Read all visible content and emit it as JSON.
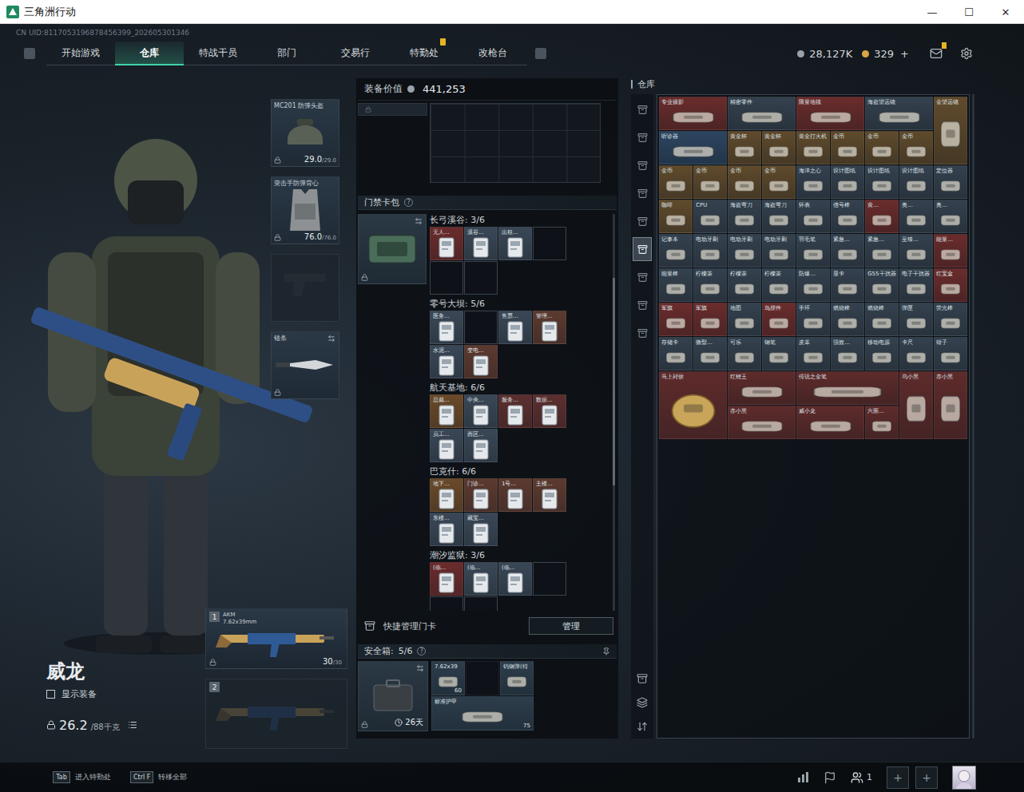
{
  "window": {
    "title": "三角洲行动",
    "controls": [
      "—",
      "☐",
      "✕"
    ]
  },
  "uid": "CN UID:8117053196878456399_202605301346",
  "nav": {
    "tabs": [
      {
        "label": "开始游戏",
        "selected": false,
        "badge": false
      },
      {
        "label": "仓库",
        "selected": true,
        "badge": false
      },
      {
        "label": "特战干员",
        "selected": false,
        "badge": false
      },
      {
        "label": "部门",
        "selected": false,
        "badge": false
      },
      {
        "label": "交易行",
        "selected": false,
        "badge": false
      },
      {
        "label": "特勤处",
        "selected": false,
        "badge": true
      },
      {
        "label": "改枪台",
        "selected": false,
        "badge": false
      }
    ],
    "coins": "28,127K",
    "points": "329",
    "add": "+",
    "mail_badge": true
  },
  "character": {
    "name": "威龙",
    "show_gear": {
      "label": "显示装备",
      "checked": false
    },
    "weight": "26.2",
    "weight_max": "/88千克"
  },
  "gear_slots": [
    {
      "kind": "helmet",
      "name": "MC201 防弹头盔",
      "durability": "29.0",
      "durability_max": "/29.0",
      "filled": true,
      "swap": false
    },
    {
      "kind": "armor",
      "name": "突击手防弹背心",
      "durability": "76.0",
      "durability_max": "/76.0",
      "filled": true,
      "swap": false
    },
    {
      "kind": "pistol",
      "name": "",
      "durability": "",
      "durability_max": "",
      "filled": false,
      "swap": false
    },
    {
      "kind": "melee",
      "name": "错条",
      "durability": "",
      "durability_max": "",
      "filled": true,
      "swap": true
    }
  ],
  "weapons": [
    {
      "index": "1",
      "name": "AKM",
      "caliber": "7.62x39mm",
      "ammo": "30",
      "ammo_max": "/30",
      "filled": true
    },
    {
      "index": "2",
      "name": "",
      "caliber": "",
      "ammo": "",
      "ammo_max": "",
      "filled": false
    }
  ],
  "loadout_value": {
    "label": "装备价值",
    "value": "441,253"
  },
  "keycards": {
    "title": "门禁卡包",
    "help": "?",
    "maps": [
      {
        "name": "长弓溪谷: 3/6",
        "cards": [
          {
            "label": "无人...",
            "filled": true,
            "color": "#6a2c2c"
          },
          {
            "label": "溪谷...",
            "filled": true,
            "color": "#3a4756"
          },
          {
            "label": "出租...",
            "filled": true,
            "color": "#3a4756"
          },
          {
            "label": "",
            "filled": false,
            "color": "#000000"
          },
          {
            "label": "",
            "filled": false,
            "color": "#000000"
          },
          {
            "label": "",
            "filled": false,
            "color": "#000000"
          }
        ]
      },
      {
        "name": "零号大坝: 5/6",
        "cards": [
          {
            "label": "医务...",
            "filled": true,
            "color": "#3a4756"
          },
          {
            "label": "",
            "filled": false,
            "color": "#000000"
          },
          {
            "label": "售票...",
            "filled": true,
            "color": "#3a4756"
          },
          {
            "label": "管理...",
            "filled": true,
            "color": "#5c3a30"
          },
          {
            "label": "水泥...",
            "filled": true,
            "color": "#3a4756"
          },
          {
            "label": "变电...",
            "filled": true,
            "color": "#5c3a30"
          }
        ]
      },
      {
        "name": "航天基地: 6/6",
        "cards": [
          {
            "label": "总裁...",
            "filled": true,
            "color": "#6a4a2a"
          },
          {
            "label": "中央...",
            "filled": true,
            "color": "#3a4756"
          },
          {
            "label": "服务...",
            "filled": true,
            "color": "#5c2f2f"
          },
          {
            "label": "数据...",
            "filled": true,
            "color": "#5c2f2f"
          },
          {
            "label": "员工...",
            "filled": true,
            "color": "#3a4756"
          },
          {
            "label": "西区...",
            "filled": true,
            "color": "#3a4756"
          }
        ]
      },
      {
        "name": "巴克什: 6/6",
        "cards": [
          {
            "label": "地下...",
            "filled": true,
            "color": "#6a4a2a"
          },
          {
            "label": "门诊...",
            "filled": true,
            "color": "#5c3a30"
          },
          {
            "label": "1号...",
            "filled": true,
            "color": "#5c3a30"
          },
          {
            "label": "主楼...",
            "filled": true,
            "color": "#5c3a30"
          },
          {
            "label": "东楼...",
            "filled": true,
            "color": "#3a4756"
          },
          {
            "label": "藏宝...",
            "filled": true,
            "color": "#3a4756"
          }
        ]
      },
      {
        "name": "潮汐监狱: 3/6",
        "cards": [
          {
            "label": "(临...",
            "filled": true,
            "color": "#6a2c2c"
          },
          {
            "label": "(临...",
            "filled": true,
            "color": "#3a4756"
          },
          {
            "label": "(临...",
            "filled": true,
            "color": "#3a4756"
          },
          {
            "label": "",
            "filled": false,
            "color": "#000000"
          },
          {
            "label": "",
            "filled": false,
            "color": "#000000"
          },
          {
            "label": "",
            "filled": false,
            "color": "#000000"
          }
        ]
      }
    ],
    "quick": "快捷管理门卡",
    "manage": "管理"
  },
  "safe": {
    "title": "安全箱:",
    "count": "5/6",
    "help": "?",
    "days": "26天",
    "items": [
      {
        "label": "7.62x39",
        "count": "60",
        "kind": "small",
        "filled": true
      },
      {
        "label": "",
        "count": "",
        "kind": "small",
        "filled": false
      },
      {
        "label": "钨钢弹(特",
        "count": "",
        "kind": "small",
        "filled": true
      },
      {
        "label": "标准护甲",
        "count": "75",
        "kind": "long",
        "filled": true
      }
    ]
  },
  "warehouse": {
    "title": "仓库",
    "tabs": [
      {
        "selected": false
      },
      {
        "selected": false
      },
      {
        "selected": false
      },
      {
        "selected": false
      },
      {
        "selected": false
      },
      {
        "selected": true
      },
      {
        "selected": false
      },
      {
        "selected": false
      },
      {
        "selected": false
      }
    ],
    "items": [
      {
        "label": "专业摄影",
        "kind": "wide",
        "color": "#6a2c2c"
      },
      {
        "label": "精密零件",
        "kind": "wide",
        "color": "#34414e"
      },
      {
        "label": "限量地毯",
        "kind": "wide",
        "color": "#6a2c2c"
      },
      {
        "label": "海盗望远镜",
        "kind": "wide",
        "color": "#34414e"
      },
      {
        "label": "金望远镜",
        "kind": "tall",
        "color": "#5f4a2c"
      },
      {
        "label": "听诊器",
        "kind": "wide",
        "color": "#2c4560"
      },
      {
        "label": "黄金杯",
        "kind": "small",
        "color": "#5f4a2c"
      },
      {
        "label": "黄金杯",
        "kind": "small",
        "color": "#5f4a2c"
      },
      {
        "label": "黄金打火机",
        "kind": "small",
        "color": "#5f4a2c"
      },
      {
        "label": "金币",
        "kind": "small",
        "color": "#5f4a2c"
      },
      {
        "label": "金币",
        "kind": "small",
        "color": "#5f4a2c"
      },
      {
        "label": "金币",
        "kind": "small",
        "color": "#5f4a2c"
      },
      {
        "label": "金币",
        "kind": "small",
        "color": "#5f4a2c"
      },
      {
        "label": "金币",
        "kind": "small",
        "color": "#5f4a2c"
      },
      {
        "label": "金币",
        "kind": "small",
        "color": "#5f4a2c"
      },
      {
        "label": "金币",
        "kind": "small",
        "color": "#5f4a2c"
      },
      {
        "label": "海洋之心",
        "kind": "small",
        "color": "#34414e"
      },
      {
        "label": "设计图纸",
        "kind": "small",
        "color": "#34414e"
      },
      {
        "label": "设计图纸",
        "kind": "small",
        "color": "#34414e"
      },
      {
        "label": "设计图纸",
        "kind": "small",
        "color": "#34414e"
      },
      {
        "label": "定位器",
        "kind": "small",
        "color": "#34414e"
      },
      {
        "label": "咖啡",
        "kind": "small",
        "color": "#5f4a2c"
      },
      {
        "label": "CPU",
        "kind": "small",
        "color": "#34414e"
      },
      {
        "label": "海盗弯刀",
        "kind": "small",
        "color": "#34414e"
      },
      {
        "label": "海盗弯刀",
        "kind": "small",
        "color": "#34414e"
      },
      {
        "label": "怀表",
        "kind": "small",
        "color": "#34414e"
      },
      {
        "label": "信号棒",
        "kind": "small",
        "color": "#34414e"
      },
      {
        "label": "黄...",
        "kind": "small",
        "color": "#6a2c2c"
      },
      {
        "label": "奥...",
        "kind": "small",
        "color": "#34414e"
      },
      {
        "label": "奥...",
        "kind": "small",
        "color": "#34414e"
      },
      {
        "label": "记事本",
        "kind": "small",
        "color": "#34414e"
      },
      {
        "label": "电动牙刷",
        "kind": "small",
        "color": "#34414e"
      },
      {
        "label": "电动牙刷",
        "kind": "small",
        "color": "#34414e"
      },
      {
        "label": "电动牙刷",
        "kind": "small",
        "color": "#34414e"
      },
      {
        "label": "羽毛笔",
        "kind": "small",
        "color": "#34414e"
      },
      {
        "label": "紧急...",
        "kind": "small",
        "color": "#34414e"
      },
      {
        "label": "紧急...",
        "kind": "small",
        "color": "#34414e"
      },
      {
        "label": "至臻...",
        "kind": "small",
        "color": "#34414e"
      },
      {
        "label": "能量...",
        "kind": "small",
        "color": "#6a2c2c"
      },
      {
        "label": "能量棒",
        "kind": "small",
        "color": "#34414e"
      },
      {
        "label": "柠檬茶",
        "kind": "small",
        "color": "#34414e"
      },
      {
        "label": "柠檬茶",
        "kind": "small",
        "color": "#34414e"
      },
      {
        "label": "柠檬茶",
        "kind": "small",
        "color": "#34414e"
      },
      {
        "label": "防爆...",
        "kind": "small",
        "color": "#34414e"
      },
      {
        "label": "显卡",
        "kind": "small",
        "color": "#34414e"
      },
      {
        "label": "G55干扰器",
        "kind": "small",
        "color": "#34414e"
      },
      {
        "label": "电子干扰器",
        "kind": "small",
        "color": "#34414e"
      },
      {
        "label": "红宝盒",
        "kind": "small",
        "color": "#6a2c2c"
      },
      {
        "label": "军旗",
        "kind": "small",
        "color": "#6a2c2c"
      },
      {
        "label": "军旗",
        "kind": "small",
        "color": "#6a2c2c"
      },
      {
        "label": "地图",
        "kind": "small",
        "color": "#34414e"
      },
      {
        "label": "鸟摆件",
        "kind": "small",
        "color": "#6a2c2c"
      },
      {
        "label": "手环",
        "kind": "small",
        "color": "#34414e"
      },
      {
        "label": "燃烧棒",
        "kind": "small",
        "color": "#34414e"
      },
      {
        "label": "燃烧棒",
        "kind": "small",
        "color": "#34414e"
      },
      {
        "label": "弹匣",
        "kind": "small",
        "color": "#34414e"
      },
      {
        "label": "荧光棒",
        "kind": "small",
        "color": "#34414e"
      },
      {
        "label": "存储卡",
        "kind": "small",
        "color": "#34414e"
      },
      {
        "label": "微型...",
        "kind": "small",
        "color": "#34414e"
      },
      {
        "label": "可乐",
        "kind": "small",
        "color": "#34414e"
      },
      {
        "label": "钢笔",
        "kind": "small",
        "color": "#34414e"
      },
      {
        "label": "皮革",
        "kind": "small",
        "color": "#34414e"
      },
      {
        "label": "强效...",
        "kind": "small",
        "color": "#34414e"
      },
      {
        "label": "移动电源",
        "kind": "small",
        "color": "#34414e"
      },
      {
        "label": "卡尺",
        "kind": "small",
        "color": "#34414e"
      },
      {
        "label": "钳子",
        "kind": "small",
        "color": "#34414e"
      },
      {
        "label": "马上封侯",
        "kind": "big",
        "color": "#5e2b2b"
      },
      {
        "label": "红鲤王",
        "kind": "wide",
        "color": "#5e2b2b"
      },
      {
        "label": "传说之金笔",
        "kind": "long",
        "color": "#5e2b2b"
      },
      {
        "label": "乌小黑",
        "kind": "tall",
        "color": "#5e2b2b"
      },
      {
        "label": "赤小黑",
        "kind": "tall",
        "color": "#5e2b2b"
      },
      {
        "label": "赤小黑",
        "kind": "wide",
        "color": "#5e2b2b"
      },
      {
        "label": "威小龙",
        "kind": "wide",
        "color": "#5e2b2b"
      },
      {
        "label": "六面...",
        "kind": "small",
        "color": "#5e2b2b"
      }
    ]
  },
  "bottom": {
    "hints": [
      {
        "key": "Tab",
        "label": "进入特勤处"
      },
      {
        "key": "Ctrl F",
        "label": "转移全部"
      }
    ],
    "party": "1",
    "slots": [
      "+",
      "+"
    ]
  }
}
